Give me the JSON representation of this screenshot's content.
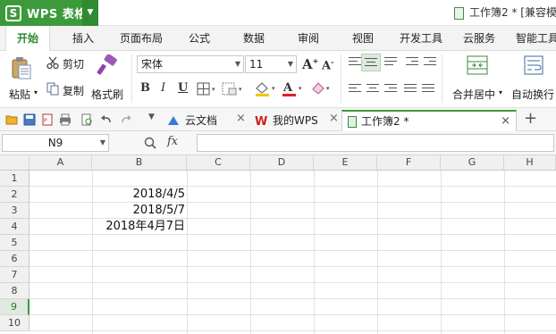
{
  "app": {
    "name": "WPS 表格",
    "logo": "S",
    "title": "工作簿2 * [兼容模"
  },
  "menu": {
    "tabs": [
      "开始",
      "插入",
      "页面布局",
      "公式",
      "数据",
      "审阅",
      "视图",
      "开发工具",
      "云服务",
      "智能工具"
    ]
  },
  "ribbon": {
    "paste": "粘贴",
    "cut": "剪切",
    "copy": "复制",
    "format_painter": "格式刷",
    "font_name": "宋体",
    "font_size": "11",
    "bold": "B",
    "italic": "I",
    "underline": "U",
    "merge_center": "合并居中",
    "wrap_text": "自动换行"
  },
  "doc_tabs": [
    {
      "label": "云文档"
    },
    {
      "label": "我的WPS"
    },
    {
      "label": "工作簿2 *"
    }
  ],
  "formula_bar": {
    "name_box": "N9",
    "fx": "fx",
    "value": ""
  },
  "sheet": {
    "columns": [
      "A",
      "B",
      "C",
      "D",
      "E",
      "F",
      "G",
      "H"
    ],
    "rows": [
      "1",
      "2",
      "3",
      "4",
      "5",
      "6",
      "7",
      "8",
      "9",
      "10"
    ],
    "selected_row": "9",
    "cells": {
      "B2": "2018/4/5",
      "B3": "2018/5/7",
      "B4": "2018年4月7日"
    }
  },
  "colors": {
    "accent": "#3c9a3c",
    "font_color": "#e02020",
    "highlight": "#f5c400"
  }
}
